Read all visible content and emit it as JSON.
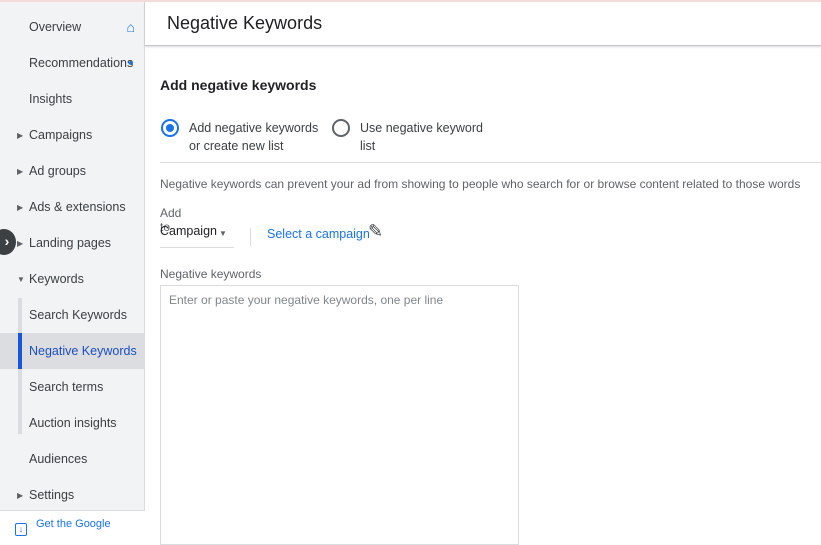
{
  "sidebar": {
    "items": [
      {
        "label": "Overview"
      },
      {
        "label": "Recommendations"
      },
      {
        "label": "Insights"
      },
      {
        "label": "Campaigns"
      },
      {
        "label": "Ad groups"
      },
      {
        "label": "Ads & extensions"
      },
      {
        "label": "Landing pages"
      },
      {
        "label": "Keywords"
      },
      {
        "label": "Search Keywords"
      },
      {
        "label": "Negative Keywords"
      },
      {
        "label": "Search terms"
      },
      {
        "label": "Auction insights"
      },
      {
        "label": "Audiences"
      },
      {
        "label": "Settings"
      }
    ],
    "footer": "Get the Google"
  },
  "header": {
    "title": "Negative Keywords"
  },
  "main": {
    "section_title": "Add negative keywords",
    "radio_add": "Add negative keywords or create new list",
    "radio_use": "Use negative keyword list",
    "description": "Negative keywords can prevent your ad from showing to people who search for or browse content related to those words",
    "add_to_label": "Add to",
    "add_to_value": "Campaign",
    "select_campaign": "Select a campaign",
    "keywords_label": "Negative keywords",
    "keywords_placeholder": "Enter or paste your negative keywords, one per line"
  }
}
